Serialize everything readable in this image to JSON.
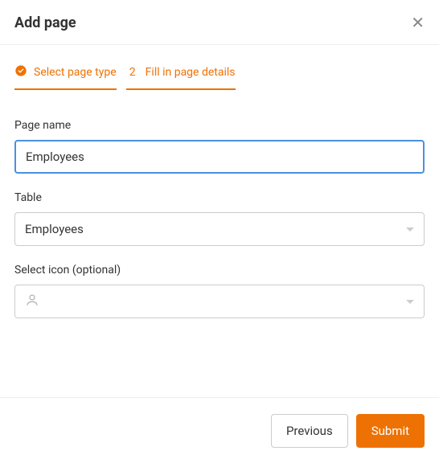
{
  "header": {
    "title": "Add page"
  },
  "steps": [
    {
      "label": "Select page type",
      "completed": true
    },
    {
      "number": "2",
      "label": "Fill in page details",
      "completed": false
    }
  ],
  "fields": {
    "page_name": {
      "label": "Page name",
      "value": "Employees"
    },
    "table": {
      "label": "Table",
      "selected": "Employees"
    },
    "icon": {
      "label": "Select icon (optional)",
      "selected_icon": "user-icon"
    }
  },
  "footer": {
    "previous": "Previous",
    "submit": "Submit"
  }
}
